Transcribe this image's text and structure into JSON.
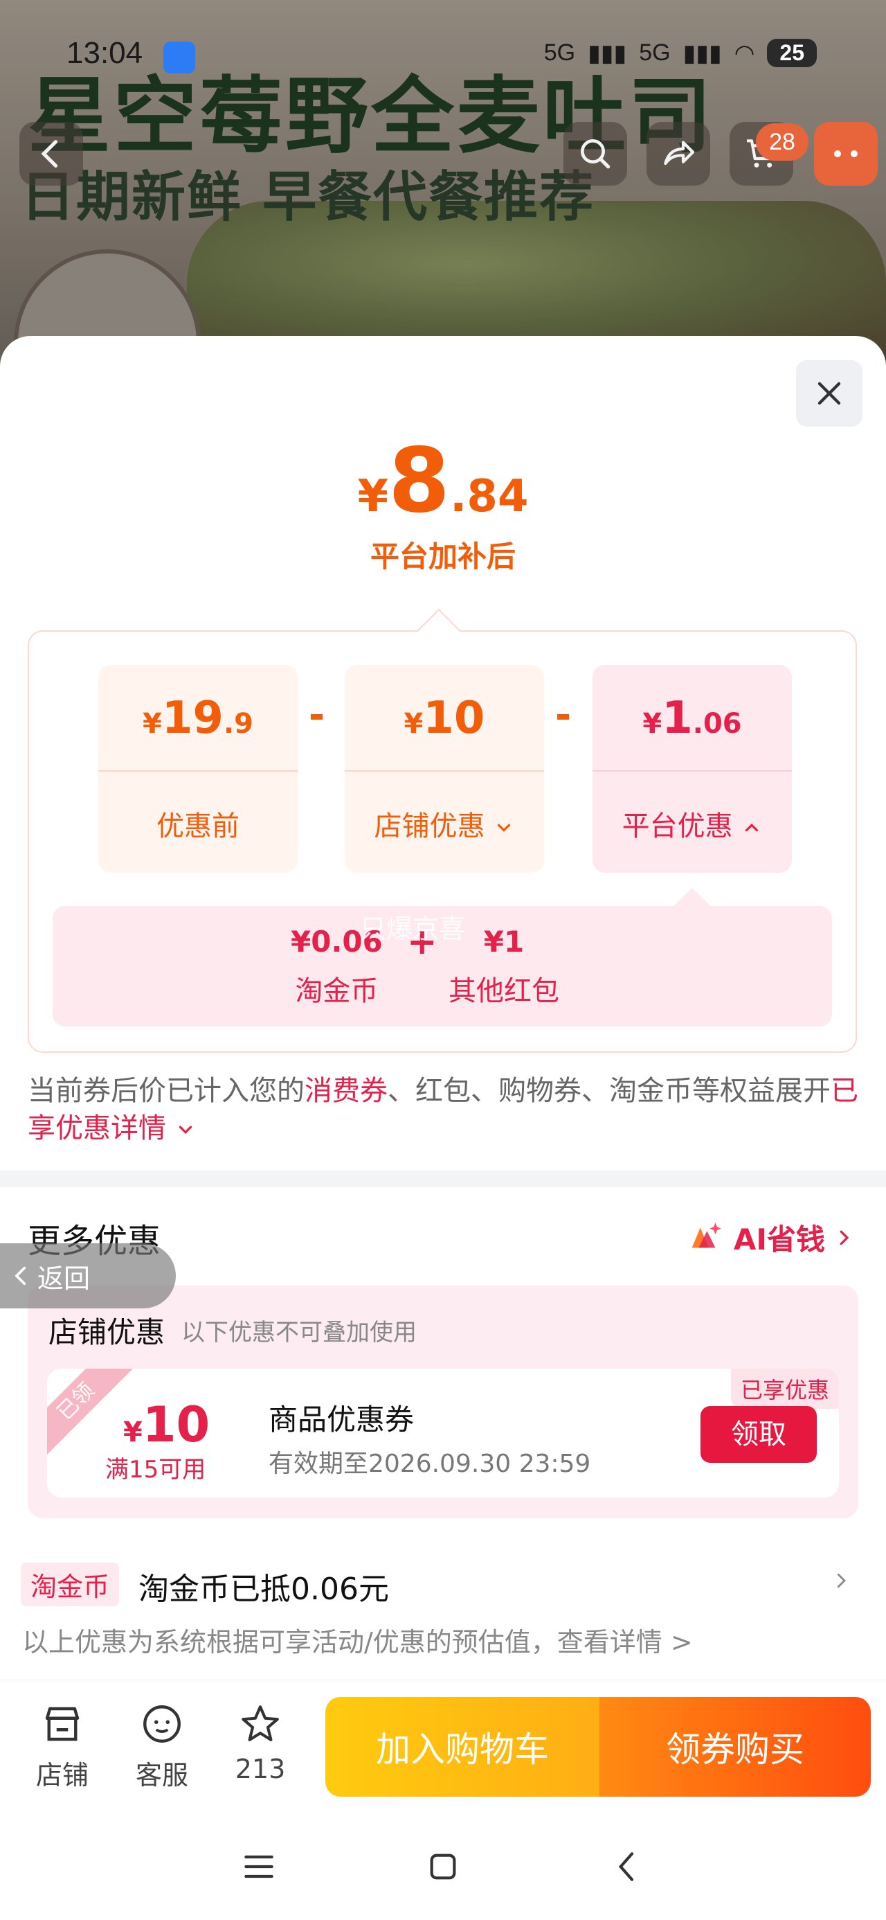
{
  "status_bar": {
    "time": "13:04",
    "signal1": "5G",
    "signal2": "5G",
    "battery": "25"
  },
  "banner": {
    "title": "星空莓野全麦吐司",
    "subtitle": "日期新鲜 早餐代餐推荐"
  },
  "header": {
    "cart_count": "28"
  },
  "price": {
    "currency": "¥",
    "integer": "8",
    "decimal": ".84",
    "label": "平台加补后"
  },
  "breakdown": {
    "before": {
      "currency": "¥",
      "integer": "19",
      "decimal": ".9",
      "label": "优惠前"
    },
    "shop": {
      "currency": "¥",
      "integer": "10",
      "decimal": "",
      "label": "店铺优惠"
    },
    "platform": {
      "currency": "¥",
      "integer": "1",
      "decimal": ".06",
      "label": "平台优惠"
    },
    "minus": "-",
    "platform_detail": [
      {
        "value": "¥0.06",
        "label": "淘金币"
      },
      {
        "value": "¥1",
        "label": "其他红包"
      }
    ],
    "plus": "+",
    "watermark": "只爆京喜"
  },
  "note": {
    "prefix": "当前券后价已计入您的",
    "highlight1": "消费券",
    "middle": "、红包、购物券、淘金币等权益展开",
    "highlight2": "已享优惠详情"
  },
  "more": {
    "title": "更多优惠",
    "ai_label": "AI省钱",
    "back_label": "返回"
  },
  "shop_offer": {
    "title": "店铺优惠",
    "note": "以下优惠不可叠加使用",
    "coupon": {
      "ribbon": "已领",
      "currency": "¥",
      "amount": "10",
      "condition": "满15可用",
      "name": "商品优惠券",
      "valid": "有效期至2026.09.30 23:59",
      "used_tag": "已享优惠",
      "claim_label": "领取"
    }
  },
  "gold": {
    "tag": "淘金币",
    "text": "淘金币已抵0.06元"
  },
  "disclaimer": "以上优惠为系统根据可享活动/优惠的预估值，查看详情 >",
  "actions": {
    "shop": "店铺",
    "service": "客服",
    "favorites": "213",
    "add_cart": "加入购物车",
    "buy": "领券购买"
  },
  "colors": {
    "accent_orange": "#f25d0a",
    "accent_red": "#e3214a",
    "cta_yellow": "#ffcb0f",
    "cta_orange": "#ff4d10"
  },
  "icons": [
    "back-icon",
    "search-icon",
    "share-icon",
    "cart-icon",
    "more-icon",
    "close-icon",
    "chevron-down-icon",
    "chevron-up-icon",
    "chevron-right-icon",
    "ai-sparkle-icon",
    "shop-icon",
    "service-icon",
    "star-icon",
    "menu-icon",
    "home-icon",
    "nav-back-icon"
  ]
}
